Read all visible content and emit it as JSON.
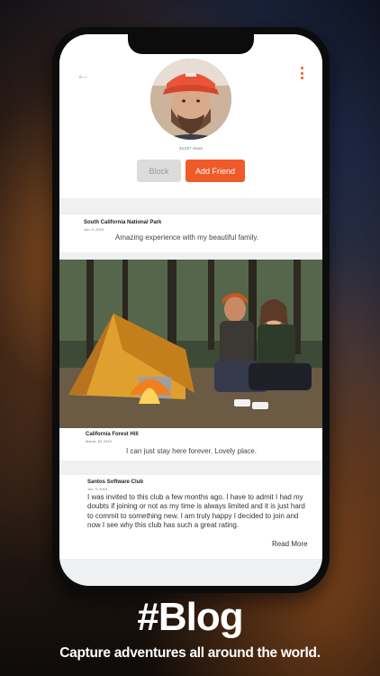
{
  "profile": {
    "views": "34,527 views",
    "block_label": "Block",
    "add_friend_label": "Add Friend"
  },
  "posts": [
    {
      "title": "South California National Park",
      "date": "Jun. 9, 2019",
      "text": "Amazing experience with my beautiful family."
    },
    {
      "title": "California Forest Hill",
      "date": "March, 18, 2019",
      "text": "I can just stay here forever. Lovely place."
    },
    {
      "title": "Santos Software Club",
      "date": "Jun. 9, 2019",
      "text": "I was invited to this club a few months ago. I have to admit I had my doubts if joining or not as my time is always limited and it is just hard to commit to something new. I am truly happy I decided to join and now I see why this club has such a great rating.",
      "read_more": "Read More"
    }
  ],
  "caption": {
    "hashtag": "#Blog",
    "subtitle": "Capture adventures all around the world."
  },
  "colors": {
    "accent": "#f05a28",
    "block_bg": "#dcdcdc"
  },
  "icons": {
    "back": "arrow-left-icon",
    "more": "more-vertical-icon"
  }
}
